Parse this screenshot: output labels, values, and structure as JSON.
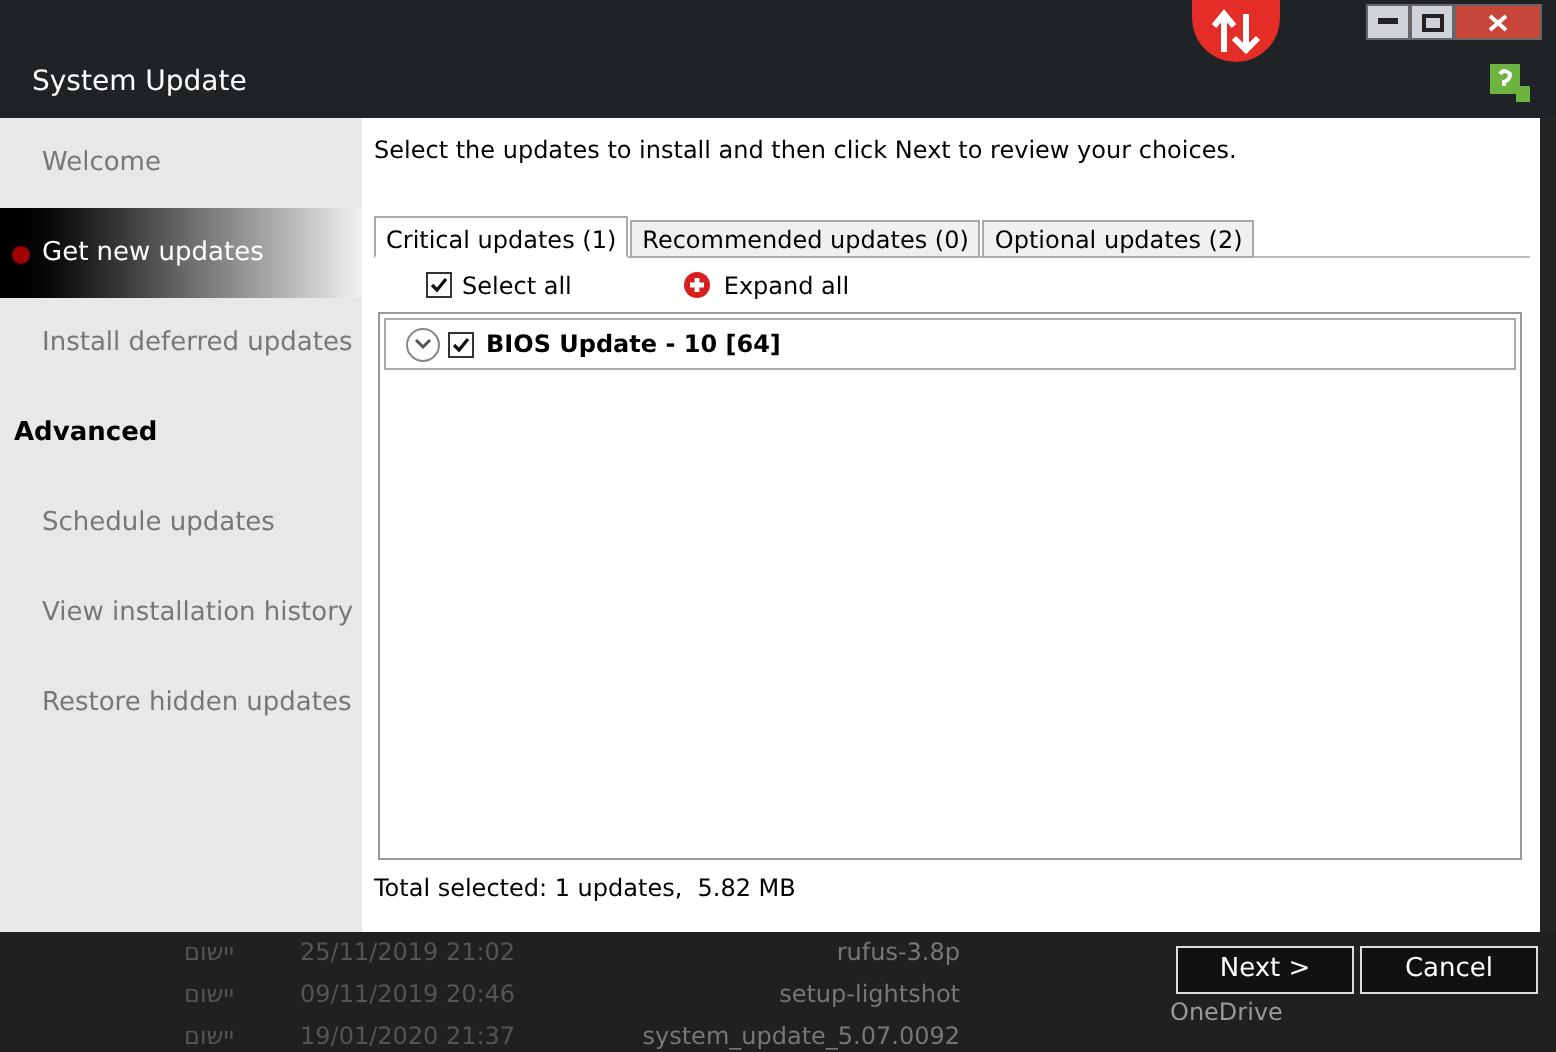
{
  "window": {
    "title": "System Update"
  },
  "sidebar": {
    "items": [
      {
        "kind": "link",
        "label": "Welcome",
        "selected": false
      },
      {
        "kind": "link",
        "label": "Get new updates",
        "selected": true
      },
      {
        "kind": "link",
        "label": "Install deferred updates",
        "selected": false
      },
      {
        "kind": "heading",
        "label": "Advanced"
      },
      {
        "kind": "link",
        "label": "Schedule updates",
        "selected": false
      },
      {
        "kind": "link",
        "label": "View installation history",
        "selected": false
      },
      {
        "kind": "link",
        "label": "Restore hidden updates",
        "selected": false
      }
    ]
  },
  "instructions": "Select the updates to install and then click Next to review your choices.",
  "tabs": [
    {
      "label": "Critical updates (1)",
      "selected": true
    },
    {
      "label": "Recommended updates (0)",
      "selected": false
    },
    {
      "label": "Optional updates (2)",
      "selected": false
    }
  ],
  "toolbar": {
    "select_all": {
      "label": "Select all",
      "checked": true
    },
    "expand_all": {
      "label": "Expand all"
    }
  },
  "updates": [
    {
      "name": "BIOS Update - 10 [64]",
      "checked": true,
      "expanded": false
    }
  ],
  "total": "Total selected: 1 updates,  5.82 MB",
  "buttons": [
    {
      "label": "Next >"
    },
    {
      "label": "Cancel"
    }
  ],
  "background_files": [
    {
      "name": "rufus-3.8p",
      "date": "25/11/2019 21:02",
      "type": "יישום"
    },
    {
      "name": "setup-lightshot",
      "date": "09/11/2019 20:46",
      "type": "יישום"
    },
    {
      "name": "system_update_5.07.0092",
      "date": "19/01/2020 21:37",
      "type": "יישום"
    }
  ],
  "background_folder": "OneDrive"
}
